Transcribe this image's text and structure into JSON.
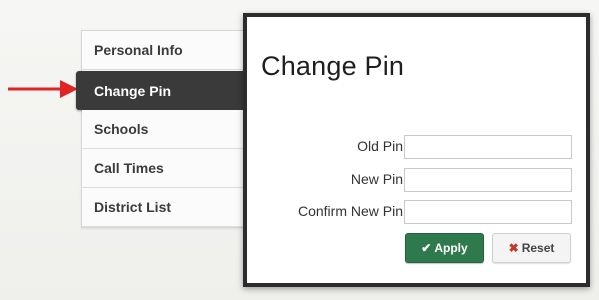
{
  "sidebar": {
    "items": [
      {
        "label": "Personal Info",
        "active": false
      },
      {
        "label": "Change Pin",
        "active": true
      },
      {
        "label": "Schools",
        "active": false
      },
      {
        "label": "Call Times",
        "active": false
      },
      {
        "label": "District List",
        "active": false
      }
    ]
  },
  "modal": {
    "title": "Change Pin",
    "fields": [
      {
        "label": "Old Pin",
        "value": ""
      },
      {
        "label": "New Pin",
        "value": ""
      },
      {
        "label": "Confirm New Pin",
        "value": ""
      }
    ],
    "buttons": {
      "apply_label": "Apply",
      "apply_icon": "checkmark-icon",
      "reset_label": "Reset",
      "reset_icon": "x-icon"
    }
  },
  "colors": {
    "arrow": "#e02424",
    "active_item_bg": "#3a3a3a",
    "apply_bg": "#2f7a4c",
    "reset_x": "#c0392b"
  }
}
